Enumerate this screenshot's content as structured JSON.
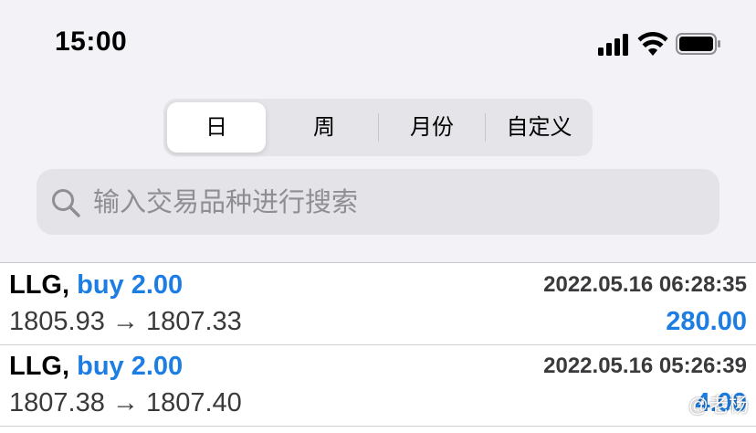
{
  "status_bar": {
    "time": "15:00",
    "icons": [
      "cellular-signal-icon",
      "wifi-icon",
      "battery-icon"
    ]
  },
  "period_tabs": {
    "items": [
      "日",
      "周",
      "月份",
      "自定义"
    ],
    "selected": "日"
  },
  "search": {
    "placeholder": "输入交易品种进行搜索",
    "value": ""
  },
  "trades": [
    {
      "symbol": "LLG,",
      "action": "buy 2.00",
      "datetime": "2022.05.16 06:28:35",
      "prices": "1805.93 → 1807.33",
      "profit": "280.00"
    },
    {
      "symbol": "LLG,",
      "action": "buy 2.00",
      "datetime": "2022.05.16 05:26:39",
      "prices": "1807.38 → 1807.40",
      "profit": "4.00"
    }
  ],
  "watermark": "@老杨",
  "colors": {
    "accent_blue": "#1c7de2",
    "background": "#f2f2f7",
    "segment_bg": "#e4e4e9",
    "search_bg": "#e3e3e8"
  }
}
